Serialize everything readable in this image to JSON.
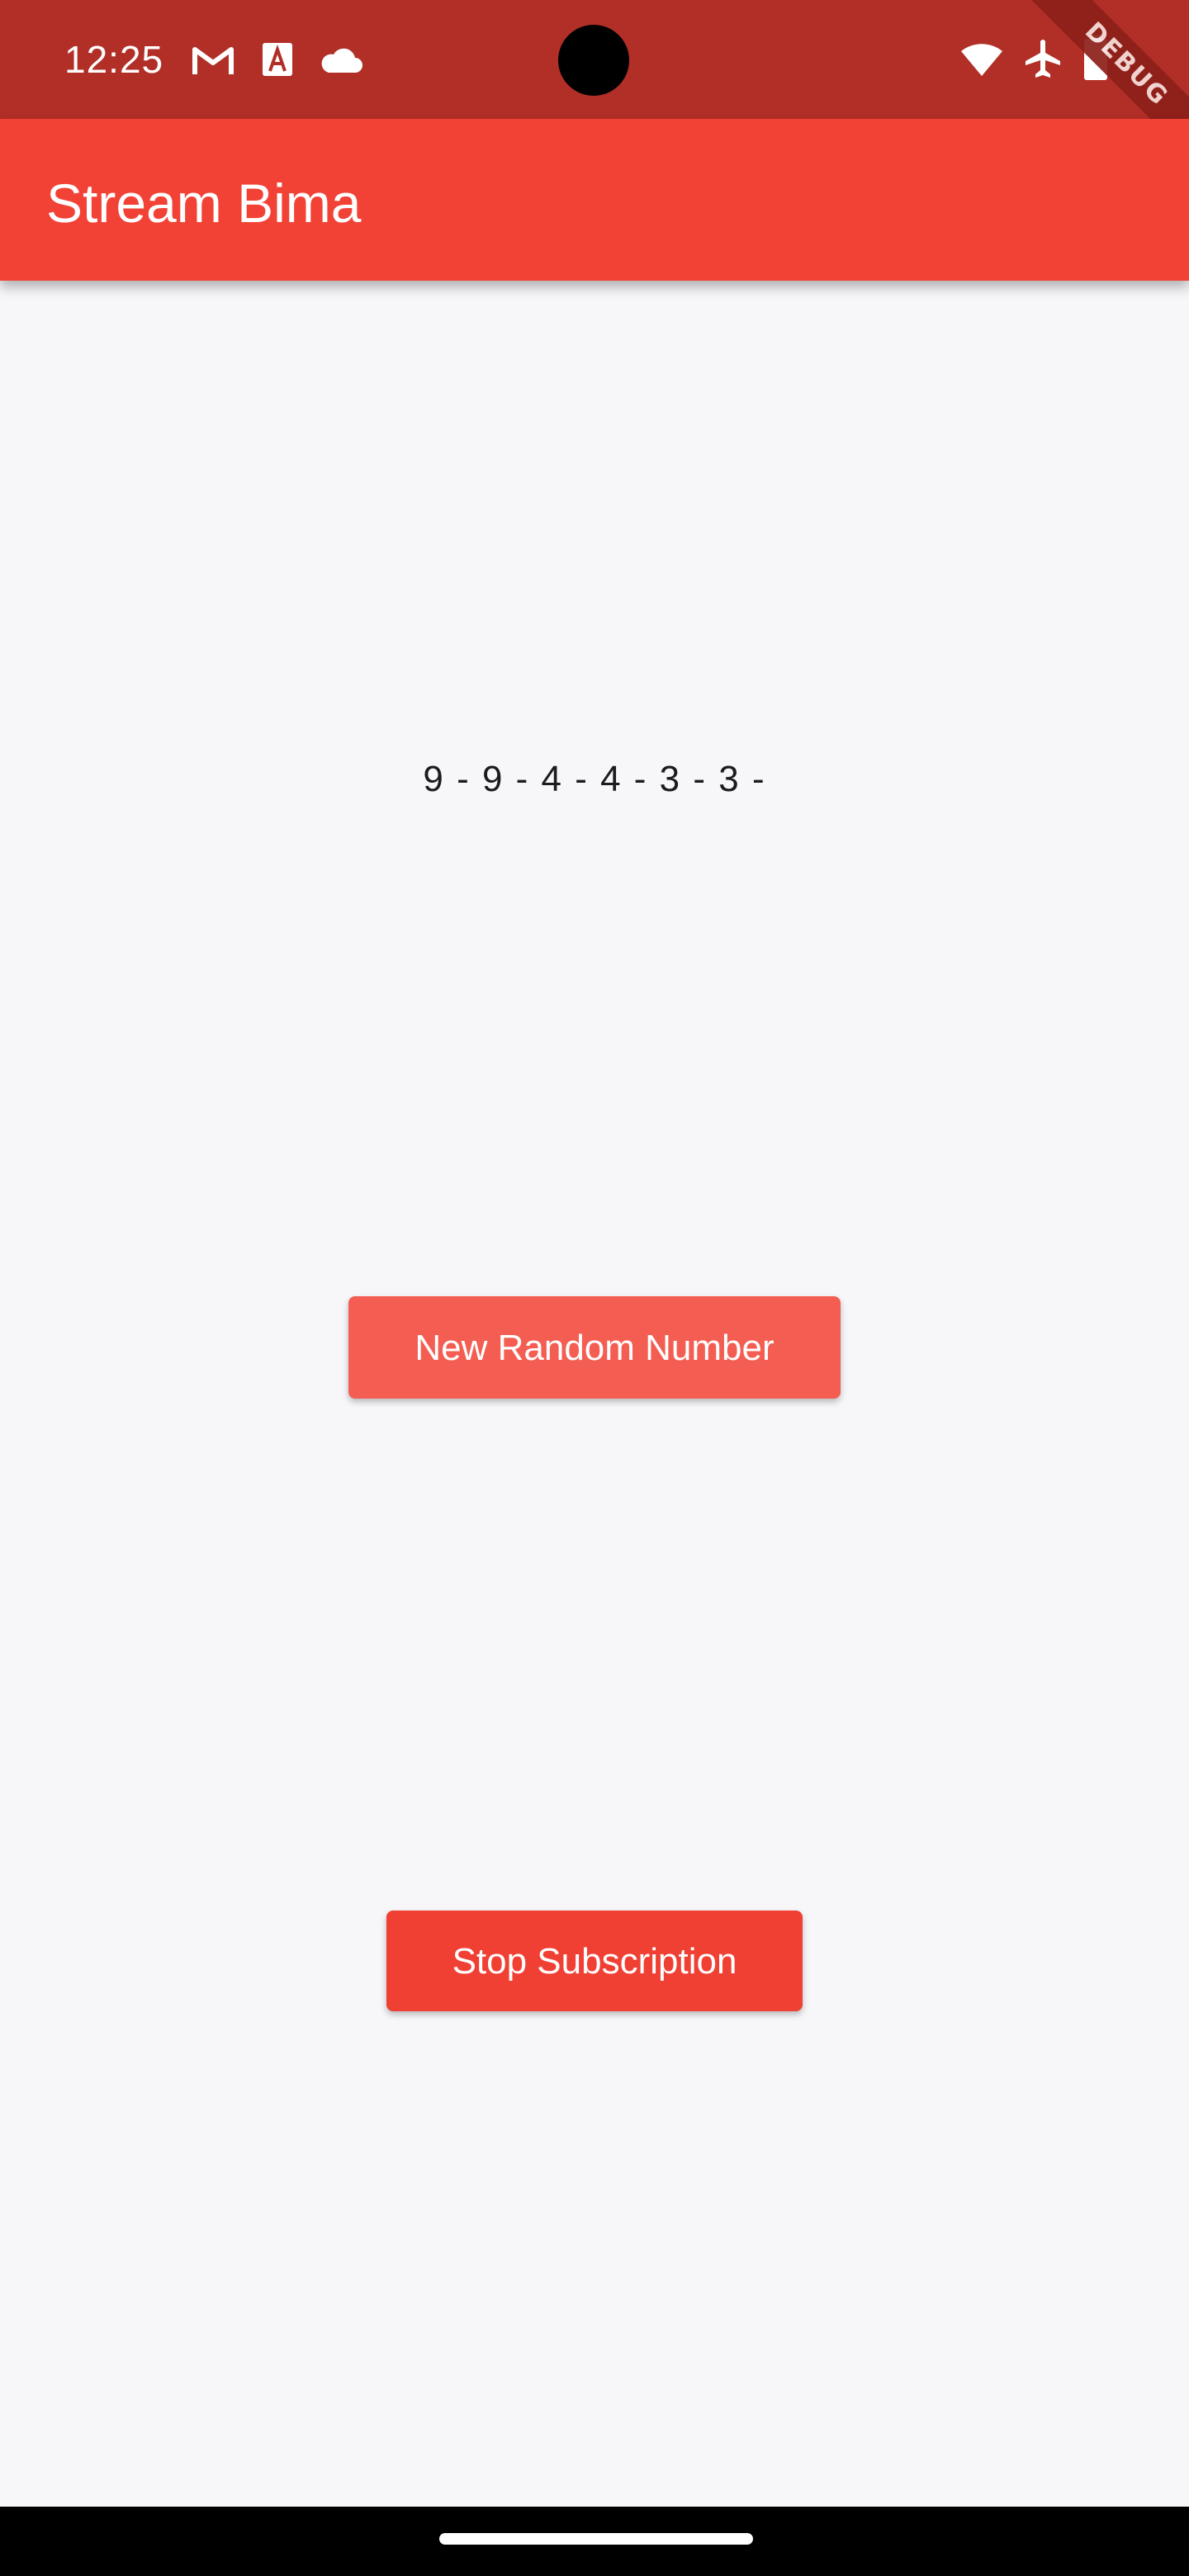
{
  "status_bar": {
    "time": "12:25",
    "left_icons": [
      "gmail-icon",
      "app-a-icon",
      "cloud-icon"
    ],
    "right_icons": [
      "wifi-icon",
      "airplane-icon",
      "battery-icon"
    ],
    "background": "#b12f26"
  },
  "debug_banner": {
    "label": "DEBUG"
  },
  "app_bar": {
    "title": "Stream Bima",
    "background": "#f24236"
  },
  "main": {
    "stream_output": "9 - 9 - 4 - 4 - 3 - 3 -",
    "new_random_button_label": "New Random Number",
    "stop_subscription_button_label": "Stop Subscription"
  },
  "colors": {
    "accent": "#f24236",
    "page_background": "#f7f6f8",
    "button_new_random": "#f45d52",
    "button_stop": "#f03f33"
  }
}
